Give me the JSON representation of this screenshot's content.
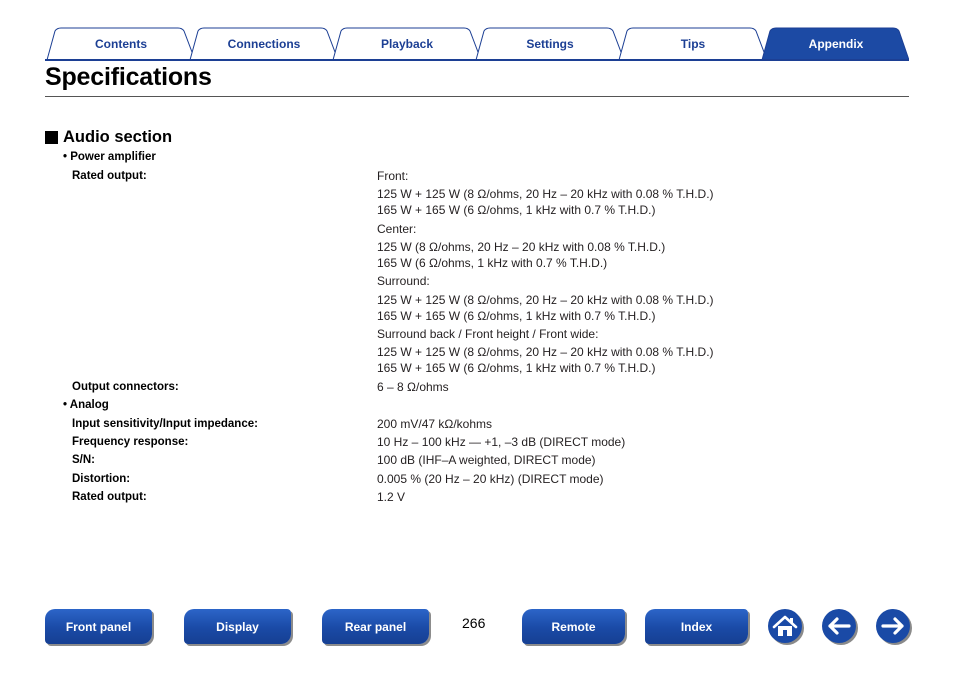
{
  "tabs": [
    {
      "label": "Contents",
      "active": false
    },
    {
      "label": "Connections",
      "active": false
    },
    {
      "label": "Playback",
      "active": false
    },
    {
      "label": "Settings",
      "active": false
    },
    {
      "label": "Tips",
      "active": false
    },
    {
      "label": "Appendix",
      "active": true
    }
  ],
  "page": {
    "title": "Specifications",
    "number": "266"
  },
  "section": {
    "heading": "Audio section",
    "power_amplifier": {
      "bullet": "• Power amplifier",
      "rated_output_label": "Rated output:",
      "rated_output_lines": [
        "Front:",
        "125 W + 125 W (8 Ω/ohms, 20 Hz – 20 kHz with 0.08 % T.H.D.)",
        "165 W + 165 W (6 Ω/ohms, 1 kHz with 0.7 % T.H.D.)",
        "Center:",
        "125 W (8 Ω/ohms, 20 Hz – 20 kHz with 0.08 % T.H.D.)",
        "165 W (6 Ω/ohms, 1 kHz with 0.7 % T.H.D.)",
        "Surround:",
        "125 W + 125 W (8 Ω/ohms, 20 Hz – 20 kHz with 0.08 % T.H.D.)",
        "165 W + 165 W (6 Ω/ohms, 1 kHz with 0.7 % T.H.D.)",
        "Surround back / Front height / Front wide:",
        "125 W + 125 W (8 Ω/ohms, 20 Hz – 20 kHz with 0.08 % T.H.D.)",
        "165 W + 165 W (6 Ω/ohms, 1 kHz with 0.7 % T.H.D.)"
      ],
      "output_connectors_label": "Output connectors:",
      "output_connectors_value": "6 – 8 Ω/ohms"
    },
    "analog": {
      "bullet": "• Analog",
      "rows": [
        {
          "label": "Input sensitivity/Input impedance:",
          "value": "200 mV/47 kΩ/kohms"
        },
        {
          "label": "Frequency response:",
          "value": "10 Hz – 100 kHz — +1, –3 dB (DIRECT mode)"
        },
        {
          "label": "S/N:",
          "value": "100 dB (IHF–A weighted, DIRECT mode)"
        },
        {
          "label": "Distortion:",
          "value": "0.005 % (20 Hz – 20 kHz) (DIRECT mode)"
        },
        {
          "label": "Rated output:",
          "value": "1.2 V"
        }
      ]
    }
  },
  "footer": {
    "buttons": [
      "Front panel",
      "Display",
      "Rear panel",
      "Remote",
      "Index"
    ],
    "icons": [
      "home-icon",
      "back-arrow-icon",
      "forward-arrow-icon"
    ]
  },
  "colors": {
    "tab_text": "#1c3f94",
    "tab_active_fill": "#1c4aa4",
    "button_blue": "#1a4aa6"
  }
}
